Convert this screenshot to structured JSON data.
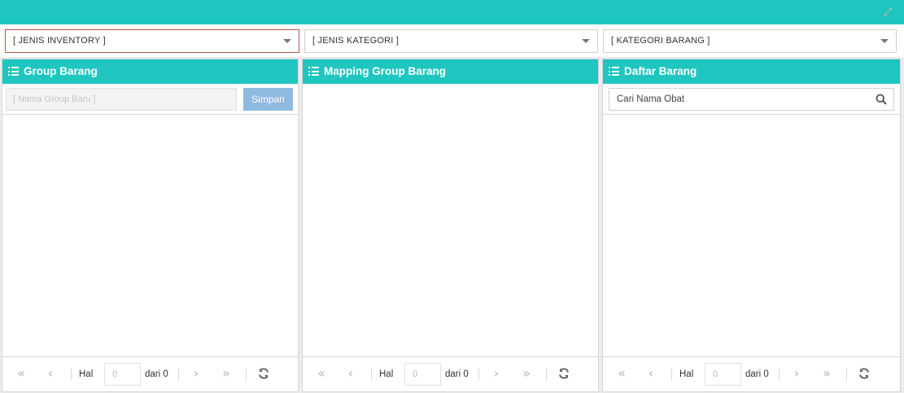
{
  "filters": {
    "jenis_inventory": "[ JENIS INVENTORY ]",
    "jenis_kategori": "[ JENIS KATEGORI ]",
    "kategori_barang": "[ KATEGORI BARANG ]"
  },
  "panels": {
    "group_barang": {
      "title": "Group Barang",
      "input_placeholder": "[ Nama Group Baru ]",
      "save_label": "Simpan"
    },
    "mapping_group_barang": {
      "title": "Mapping Group Barang"
    },
    "daftar_barang": {
      "title": "Daftar Barang",
      "search_placeholder": "Cari Nama Obat"
    }
  },
  "pager": {
    "hal_label": "Hal",
    "page_placeholder": "0",
    "dari_label": "dari 0"
  },
  "icons": {
    "first": "first-page-icon",
    "prev": "prev-page-icon",
    "next": "next-page-icon",
    "last": "last-page-icon",
    "refresh": "refresh-icon",
    "list": "list-icon",
    "search": "search-icon",
    "expand": "expand-icon"
  },
  "colors": {
    "accent": "#1fc6c0",
    "save_button": "#8fbadf",
    "active_border": "#b9504e"
  }
}
